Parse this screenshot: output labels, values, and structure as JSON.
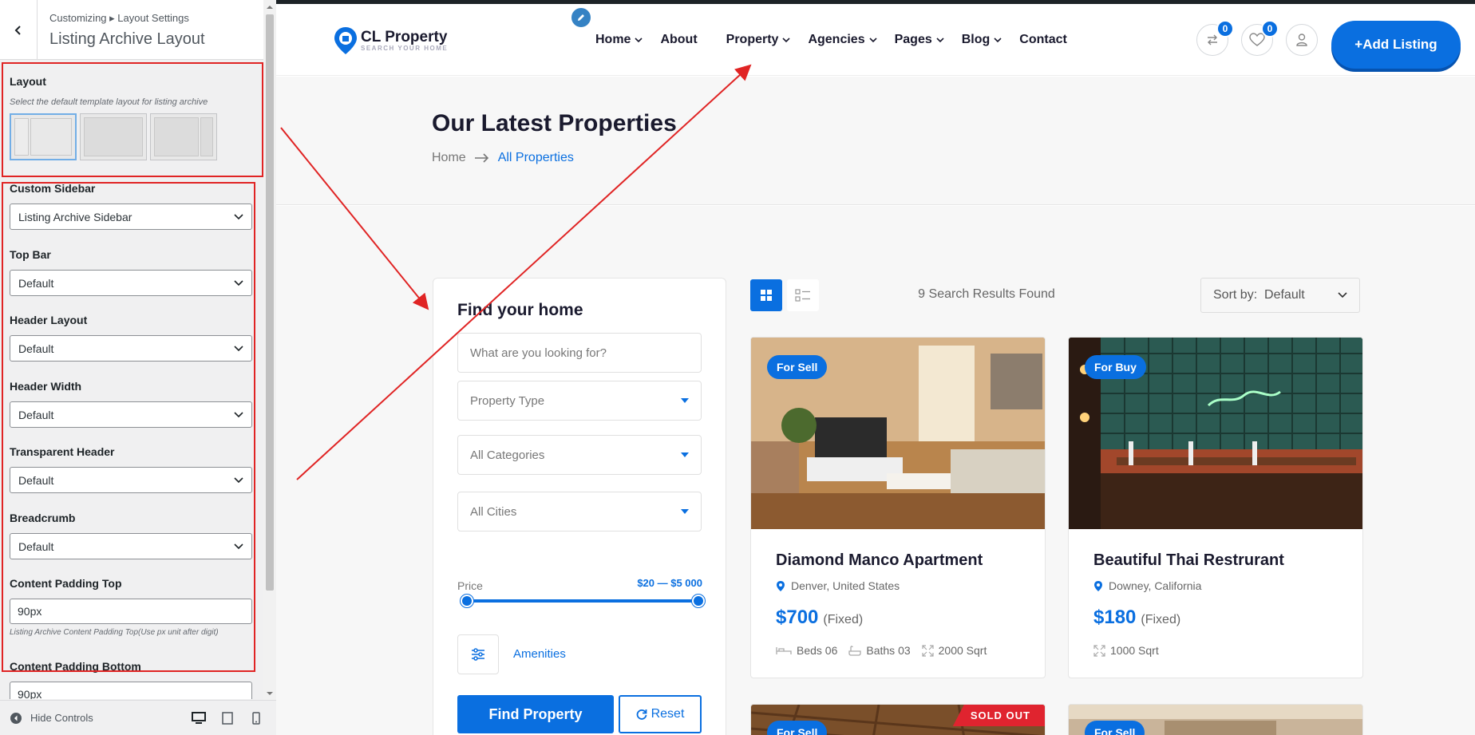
{
  "customizer": {
    "breadcrumb": "Customizing ▸ Layout Settings",
    "title": "Listing Archive Layout",
    "layout": {
      "label": "Layout",
      "description": "Select the default template layout for listing archive"
    },
    "custom_sidebar": {
      "label": "Custom Sidebar",
      "value": "Listing Archive Sidebar"
    },
    "top_bar": {
      "label": "Top Bar",
      "value": "Default"
    },
    "header_layout": {
      "label": "Header Layout",
      "value": "Default"
    },
    "header_width": {
      "label": "Header Width",
      "value": "Default"
    },
    "transparent_header": {
      "label": "Transparent Header",
      "value": "Default"
    },
    "breadcrumb_setting": {
      "label": "Breadcrumb",
      "value": "Default"
    },
    "content_padding_top": {
      "label": "Content Padding Top",
      "value": "90px",
      "description": "Listing Archive Content Padding Top(Use px unit after digit)"
    },
    "content_padding_bottom": {
      "label": "Content Padding Bottom",
      "value": "90px"
    },
    "footer": {
      "hide_controls": "Hide Controls"
    }
  },
  "site": {
    "logo": {
      "name": "CL Property",
      "tagline": "SEARCH YOUR HOME"
    },
    "nav": [
      {
        "label": "Home",
        "dropdown": true
      },
      {
        "label": "About",
        "dropdown": false
      },
      {
        "label": "Property",
        "dropdown": true
      },
      {
        "label": "Agencies",
        "dropdown": true
      },
      {
        "label": "Pages",
        "dropdown": true
      },
      {
        "label": "Blog",
        "dropdown": true
      },
      {
        "label": "Contact",
        "dropdown": false
      }
    ],
    "compare_count": "0",
    "wishlist_count": "0",
    "add_listing": "+Add Listing",
    "page_title": "Our Latest Properties",
    "breadcrumb": {
      "home": "Home",
      "current": "All Properties"
    },
    "search": {
      "title": "Find your home",
      "keyword_placeholder": "What are you looking for?",
      "property_type": "Property Type",
      "categories": "All Categories",
      "cities": "All Cities",
      "price_label": "Price",
      "price_range": "$20 — $5 000",
      "amenities": "Amenities",
      "find_button": "Find Property",
      "reset_button": "Reset"
    },
    "results": {
      "count": "9 Search Results Found",
      "sort_label": "Sort by:",
      "sort_value": "Default"
    },
    "cards": [
      {
        "tag": "For Sell",
        "title": "Diamond Manco Apartment",
        "location": "Denver, United States",
        "price": "$700",
        "price_type": "(Fixed)",
        "beds": "Beds 06",
        "baths": "Baths 03",
        "area": "2000 Sqrt"
      },
      {
        "tag": "For Buy",
        "title": "Beautiful Thai Restrurant",
        "location": "Downey, California",
        "price": "$180",
        "price_type": "(Fixed)",
        "area": "1000 Sqrt"
      },
      {
        "tag": "For Sell",
        "sold_out": "SOLD OUT"
      },
      {
        "tag": "For Sell"
      }
    ]
  },
  "colors": {
    "accent": "#0a6fe0",
    "annotation": "#e02424",
    "sold_out": "#e0242f"
  }
}
